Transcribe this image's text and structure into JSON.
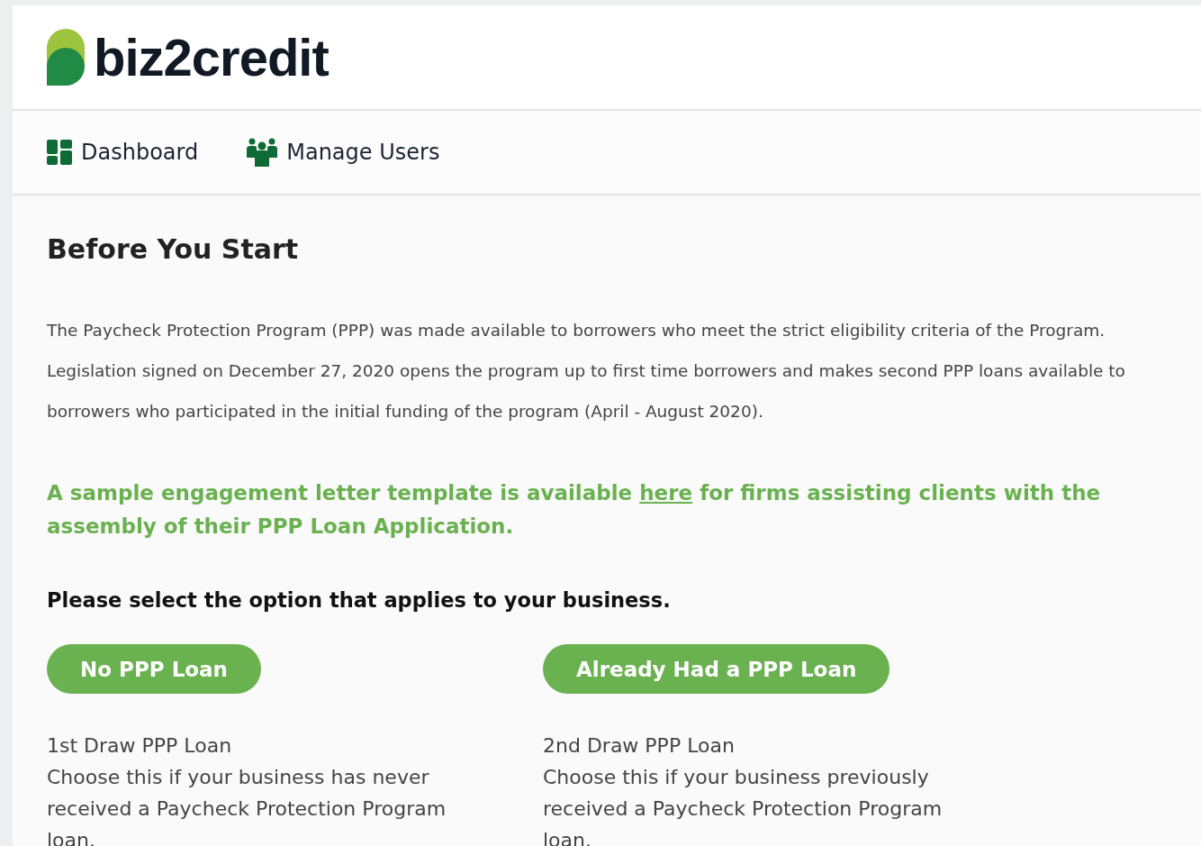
{
  "logo": {
    "text": "biz2credit"
  },
  "nav": [
    {
      "label": "Dashboard",
      "kind": "dashboard"
    },
    {
      "label": "Manage Users",
      "kind": "users"
    }
  ],
  "heading": "Before You Start",
  "intro": "The Paycheck Protection Program (PPP) was made available to borrowers who meet the strict eligibility criteria of the Program. Legislation signed on December 27, 2020 opens the program up to first time borrowers and makes second PPP loans available to borrowers who participated in the initial funding of the program (April - August 2020).",
  "notice": {
    "before": "A sample engagement letter template is available",
    "link": "here",
    "after": "for firms assisting clients with the assembly of their PPP Loan Application."
  },
  "prompt": "Please select the option that applies to your business.",
  "options": [
    {
      "button": "No PPP Loan",
      "title": "1st Draw PPP Loan",
      "description": "Choose this if your business has never received a Paycheck Protection Program loan."
    },
    {
      "button": "Already Had a PPP Loan",
      "title": "2nd Draw PPP Loan",
      "description": "Choose this if your business previously received a Paycheck Protection Program loan."
    }
  ]
}
